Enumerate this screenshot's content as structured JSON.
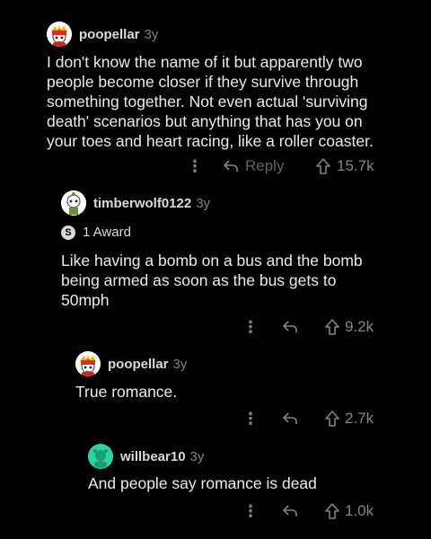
{
  "comments": [
    {
      "username": "poopellar",
      "age": "3y",
      "body": "I don't know the name of it but apparently two people become closer if they survive through something together. Not even actual 'surviving death' scenarios but anything that has you on your toes and heart racing, like a roller coaster.",
      "reply_label": "Reply",
      "votes": "15.7k"
    },
    {
      "username": "timberwolf0122",
      "age": "3y",
      "award": "1 Award",
      "award_icon": "S",
      "body": "Like having a bomb on a bus and the bomb being armed as soon as the bus gets to 50mph",
      "votes": "9.2k"
    },
    {
      "username": "poopellar",
      "age": "3y",
      "body": "True romance.",
      "votes": "2.7k"
    },
    {
      "username": "willbear10",
      "age": "3y",
      "body": "And people say romance is dead",
      "votes": "1.0k"
    }
  ],
  "icons": {
    "more": "more-options-icon",
    "reply": "reply-arrow-icon",
    "upvote": "upvote-arrow-icon"
  },
  "colors": {
    "background": "#000000",
    "text": "#e8eaed",
    "muted": "#818384",
    "willbear_avatar": "#2ed0a0"
  }
}
